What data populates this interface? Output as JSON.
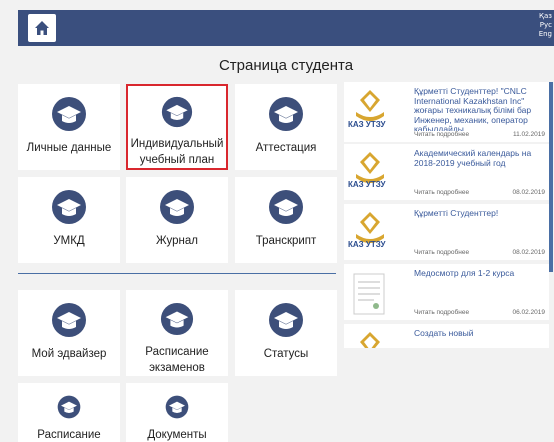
{
  "header": {
    "home_icon": "home-icon",
    "languages": [
      "Қаз",
      "Рус",
      "Eng"
    ]
  },
  "page_title": "Страница студента",
  "tiles_top": [
    {
      "label": "Личные данные",
      "icon": "graduation-cap-icon"
    },
    {
      "label": "Индивидуальный\nучебный план",
      "icon": "graduation-cap-icon",
      "selected": true
    },
    {
      "label": "Аттестация",
      "icon": "graduation-cap-icon"
    },
    {
      "label": "УМКД",
      "icon": "graduation-cap-icon"
    },
    {
      "label": "Журнал",
      "icon": "graduation-cap-icon"
    },
    {
      "label": "Транскрипт",
      "icon": "graduation-cap-icon"
    }
  ],
  "tiles_bottom": [
    {
      "label": "Мой эдвайзер",
      "icon": "graduation-cap-icon"
    },
    {
      "label": "Расписание\nэкзаменов",
      "icon": "graduation-cap-icon"
    },
    {
      "label": "Статусы",
      "icon": "graduation-cap-icon"
    },
    {
      "label": "Расписание",
      "icon": "graduation-cap-icon"
    },
    {
      "label": "Документы",
      "icon": "graduation-cap-icon"
    }
  ],
  "news": [
    {
      "logo_text": "КАЗ УТЗУ",
      "title": "Құрметті Студенттер! \"CNLC International Kazakhstan Inc\" жоғары техникалық білімі бар Инженер, механик, оператор қабылдайды.",
      "read_more": "Читать подробнее",
      "date": "11.02.2019"
    },
    {
      "logo_text": "КАЗ УТЗУ",
      "title": "Академический календарь на 2018-2019 учебный год",
      "read_more": "Читать подробнее",
      "date": "08.02.2019"
    },
    {
      "logo_text": "КАЗ УТЗУ",
      "title": "Құрметті Студенттер!",
      "read_more": "Читать подробнее",
      "date": "08.02.2019"
    },
    {
      "logo_text": "",
      "title": "Медосмотр для 1-2 курса",
      "read_more": "Читать подробнее",
      "date": "06.02.2019"
    },
    {
      "logo_text": "",
      "title": "Создать новый",
      "read_more": "",
      "date": ""
    }
  ],
  "colors": {
    "header_bg": "#3a4f7e",
    "accent": "#4a6fa5",
    "selected_border": "#d9272e",
    "news_title": "#3a5a9b"
  }
}
